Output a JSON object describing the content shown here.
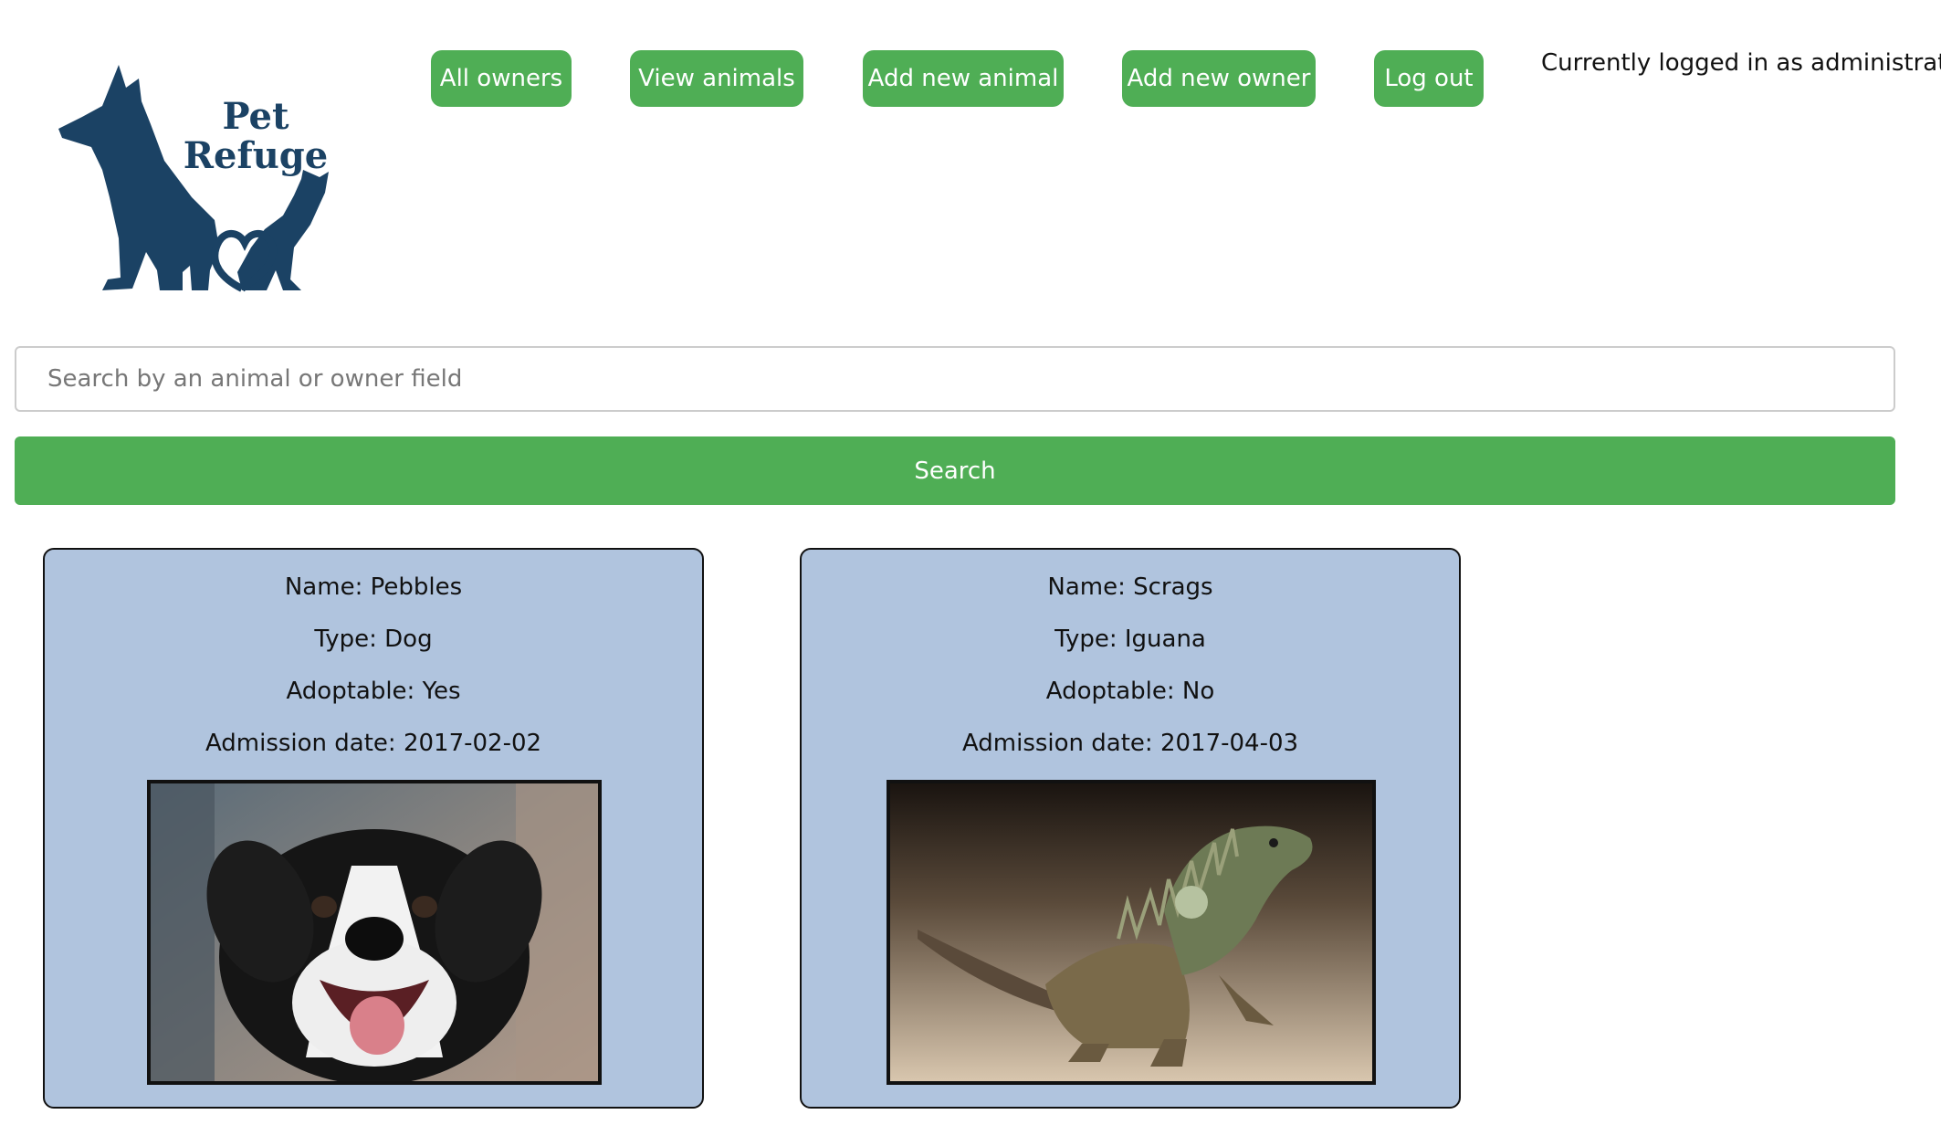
{
  "logo": {
    "line1": "Pet",
    "line2": "Refuge",
    "icon": "dog-cat-heart-logo-icon",
    "color": "#1b4264"
  },
  "nav": {
    "all_owners": "All owners",
    "view_animals": "View animals",
    "add_new_animal": "Add new animal",
    "add_new_owner": "Add new owner",
    "log_out": "Log out"
  },
  "status": {
    "logged_in_text": "Currently logged in as administrator"
  },
  "search": {
    "placeholder": "Search by an animal or owner field",
    "value": "",
    "button_label": "Search"
  },
  "colors": {
    "accent_green": "#4fae55",
    "card_background": "#b0c4de",
    "logo_navy": "#1b4264"
  },
  "animals": [
    {
      "name": "Name: Pebbles",
      "type": "Type: Dog",
      "adoptable": "Adoptable: Yes",
      "admission_date": "Admission date: 2017-02-02",
      "photo_icon": "dog-photo"
    },
    {
      "name": "Name: Scrags",
      "type": "Type: Iguana",
      "adoptable": "Adoptable: No",
      "admission_date": "Admission date: 2017-04-03",
      "photo_icon": "iguana-photo"
    }
  ]
}
